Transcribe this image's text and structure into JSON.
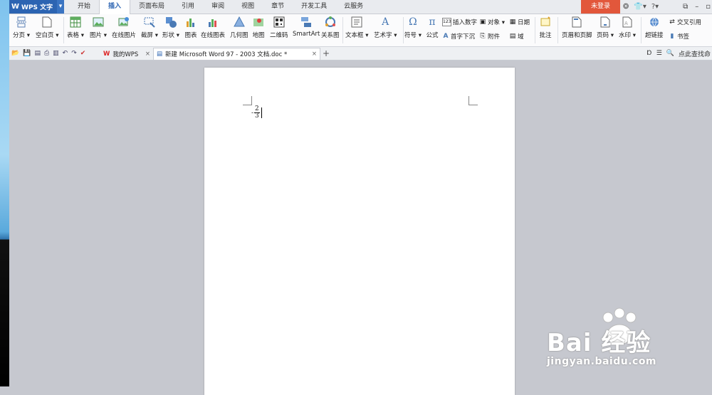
{
  "app": {
    "logo": "W",
    "name": "WPS 文字",
    "dropdown": "▾"
  },
  "menu_tabs": [
    "开始",
    "插入",
    "页面布局",
    "引用",
    "审阅",
    "视图",
    "章节",
    "开发工具",
    "云服务"
  ],
  "active_tab": "插入",
  "login_label": "未登录",
  "ribbon": {
    "blank_page": "分页 ▾",
    "empty_page": "空白页 ▾",
    "table": "表格 ▾",
    "picture": "图片 ▾",
    "online_picture": "在线图片",
    "screenshot": "截屏 ▾",
    "shape": "形状 ▾",
    "chart": "图表",
    "online_chart": "在线图表",
    "geometry": "几何图",
    "map": "地图",
    "qrcode": "二维码",
    "smartart": "SmartArt",
    "relation": "关系图",
    "textbox": "文本框 ▾",
    "wordart": "艺术字 ▾",
    "symbol": "符号 ▾",
    "formula": "公式",
    "insert_number": "插入数字",
    "object": "对象 ▾",
    "date": "日期",
    "dropcap": "首字下沉",
    "attachment": "附件",
    "field": "域",
    "comment": "批注",
    "header_footer": "页眉和页脚",
    "page_number": "页码 ▾",
    "watermark": "水印 ▾",
    "hyperlink": "超链接",
    "cross_ref": "交叉引用",
    "bookmark": "书签"
  },
  "doc_tabs": [
    {
      "label": "我的WPS",
      "close": "×"
    },
    {
      "label": "新建 Microsoft Word 97 - 2003 文档.doc *",
      "close": "×"
    }
  ],
  "new_tab": "+",
  "search_label": "点此查找命",
  "document": {
    "minus": "-",
    "numerator": "2",
    "denominator": "3"
  },
  "watermark": {
    "brand": "Bai  经验",
    "url": "jingyan.baidu.com"
  },
  "colors": {
    "accent": "#2c64b2",
    "login": "#e2573b",
    "workspace": "#c6c8cf"
  }
}
